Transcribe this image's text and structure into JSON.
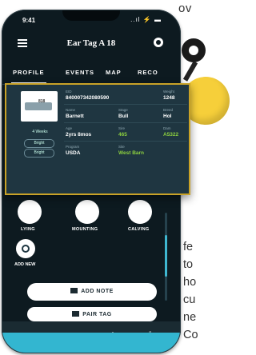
{
  "side_text": {
    "top": "ov",
    "lines": [
      "fe",
      "to",
      "ho",
      "cu",
      "ne",
      "Co"
    ]
  },
  "status_bar": {
    "time": "9:41",
    "icons": "..ıl ⚡ ▬"
  },
  "app": {
    "title": "Ear Tag A 18"
  },
  "tabs": [
    "PROFILE",
    "EVENTS",
    "MAP",
    "RECO"
  ],
  "card": {
    "thumb_label": "818",
    "thumb_caption": "4 Weeks",
    "badges": [
      "Bright",
      "Bright"
    ],
    "fields": [
      {
        "label": "EID",
        "value": "840007342080590"
      },
      {
        "label": "Weight",
        "value": "1248"
      },
      {
        "label": "Name",
        "value": "Barnett"
      },
      {
        "label": "Stage",
        "value": "Bull"
      },
      {
        "label": "Breed",
        "value": "Hol"
      },
      {
        "label": "Age",
        "value": "2yrs 8mos"
      },
      {
        "label": "Sire",
        "value": "465"
      },
      {
        "label": "Dam",
        "value": "A5322"
      },
      {
        "label": "Program",
        "value": "USDA"
      },
      {
        "label": "Site",
        "value": "West Barn"
      }
    ]
  },
  "actions": [
    "LYING",
    "MOUNTING",
    "CALVING"
  ],
  "add_new": "ADD NEW",
  "buttons": {
    "add_note": "ADD NOTE",
    "pair_tag": "PAIR TAG"
  },
  "nav": {
    "home": "⌂",
    "insights": "",
    "add": "+",
    "alerts": "♫"
  },
  "colors": {
    "phone_bg": "#0d1a20",
    "card_bg": "#1f3641",
    "card_border": "#c9a227",
    "accent": "#33b6d0",
    "green": "#8ccf3f",
    "tag_yellow": "#f6cf3a"
  }
}
